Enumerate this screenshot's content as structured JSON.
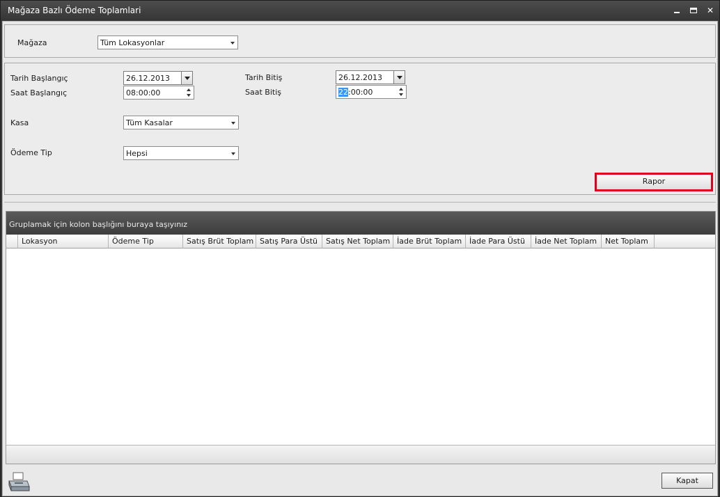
{
  "window": {
    "title": "Mağaza Bazlı Ödeme Toplamlari"
  },
  "store": {
    "label": "Mağaza",
    "value": "Tüm Lokasyonlar"
  },
  "params": {
    "start_date_label": "Tarih Başlangıç",
    "start_date": "26.12.2013",
    "start_time_label": "Saat Başlangıç",
    "start_time": "08:00:00",
    "end_date_label": "Tarih Bitiş",
    "end_date": "26.12.2013",
    "end_time_label": "Saat Bitiş",
    "end_time_hour": "22",
    "end_time_rest": ":00:00",
    "register_label": "Kasa",
    "register_value": "Tüm Kasalar",
    "payment_type_label": "Ödeme Tip",
    "payment_type_value": "Hepsi",
    "report_button": "Rapor"
  },
  "grid": {
    "group_hint": "Gruplamak için kolon başlığını buraya taşıyınız",
    "columns": [
      "Lokasyon",
      "Ödeme Tip",
      "Satış Brüt Toplam",
      "Satış Para Üstü",
      "Satış Net Toplam",
      "İade Brüt Toplam",
      "İade Para Üstü",
      "İade Net Toplam",
      "Net Toplam"
    ]
  },
  "footer": {
    "close_button": "Kapat"
  },
  "colors": {
    "highlight_border": "#e0001b",
    "selection": "#3399ff"
  },
  "icons": {
    "print": "printer-icon"
  }
}
